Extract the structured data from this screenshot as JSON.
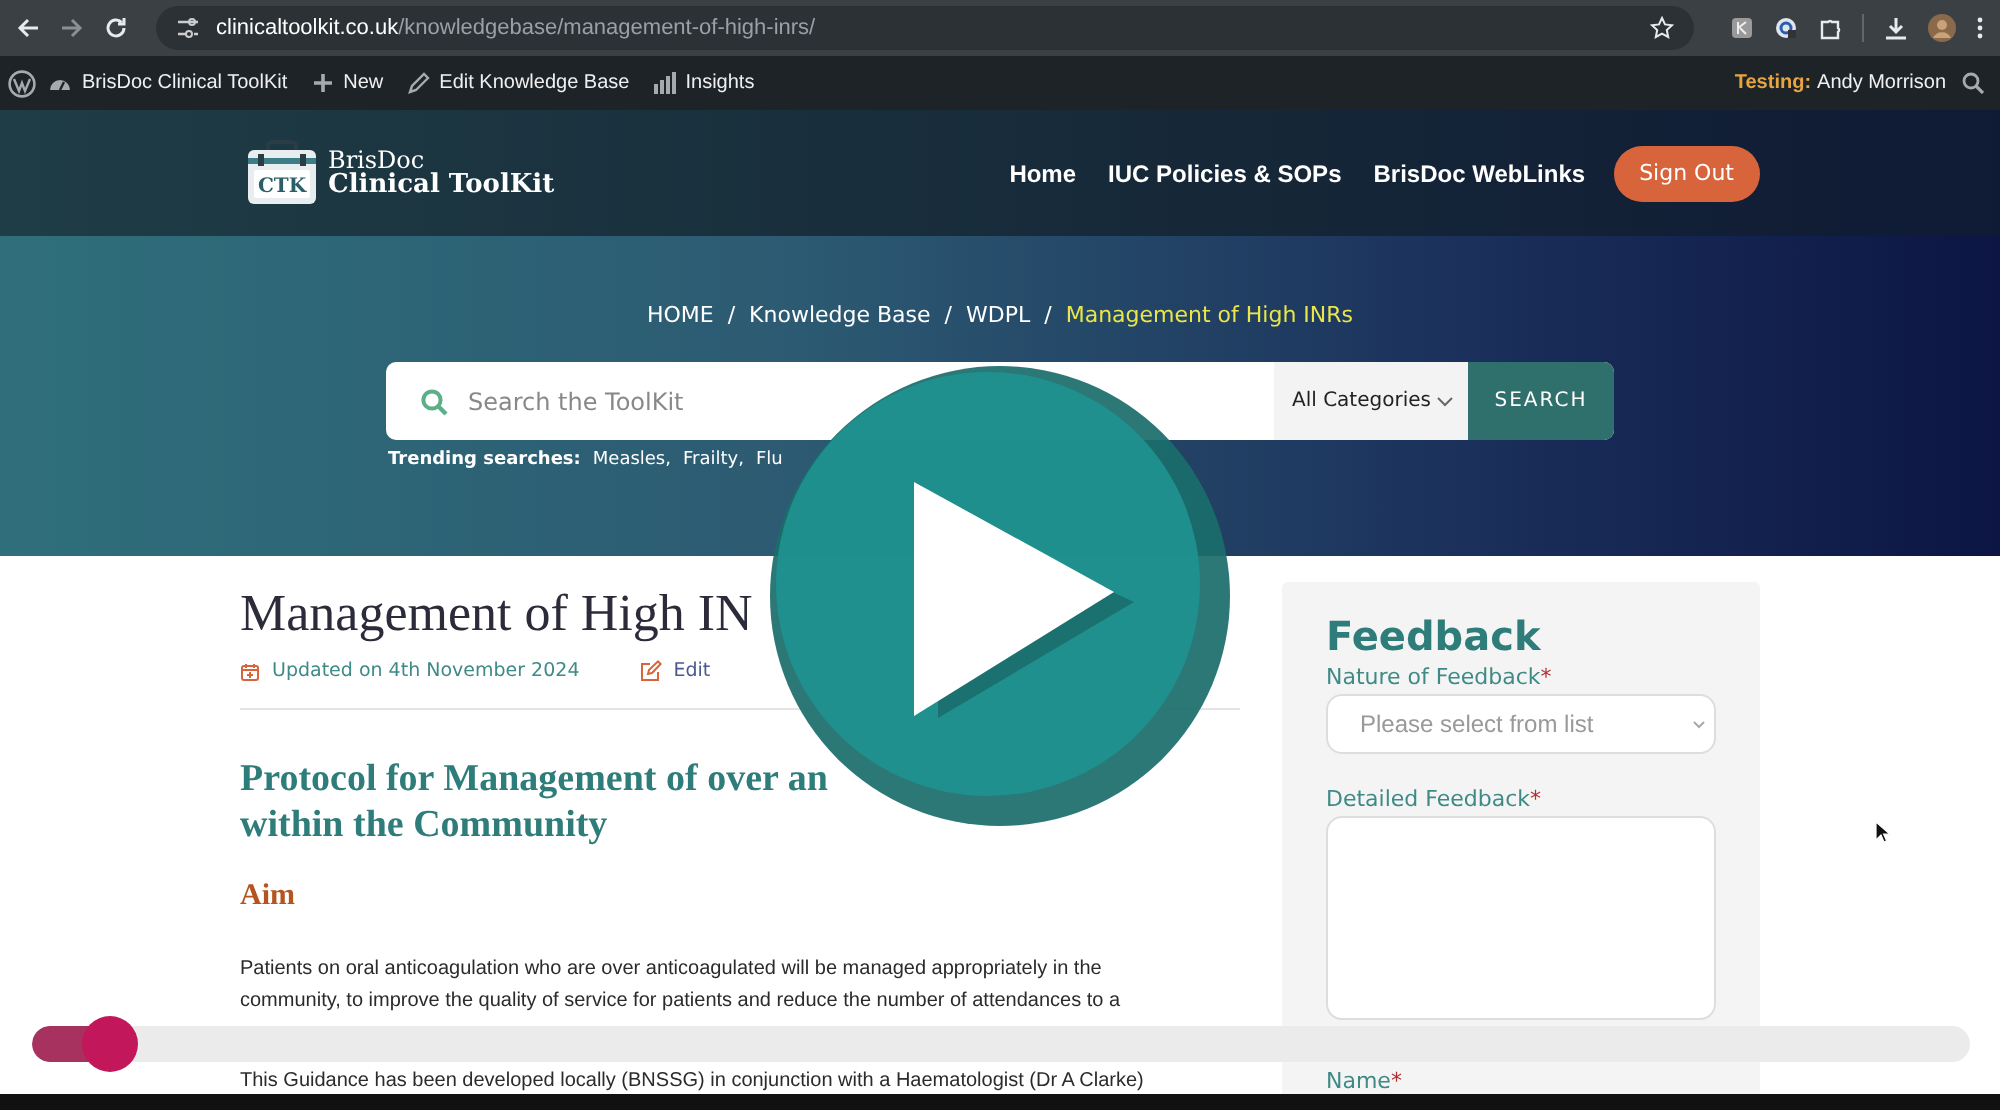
{
  "browser": {
    "url_host": "clinicaltoolkit.co.uk",
    "url_path": "/knowledgebase/management-of-high-inrs/"
  },
  "admin_bar": {
    "items": [
      {
        "label": "BrisDoc Clinical ToolKit",
        "kind": "site"
      },
      {
        "label": "New",
        "kind": "new"
      },
      {
        "label": "Edit Knowledge Base",
        "kind": "edit"
      },
      {
        "label": "Insights",
        "kind": "stats"
      }
    ],
    "testing_label": "Testing:",
    "user": "Andy Morrison"
  },
  "site_header": {
    "logo_badge": "CTK",
    "logo_line1": "BrisDoc",
    "logo_line2": "Clinical ToolKit",
    "nav": [
      "Home",
      "IUC Policies & SOPs",
      "BrisDoc WebLinks"
    ],
    "sign_out": "Sign Out"
  },
  "hero": {
    "breadcrumb_separator": "/",
    "breadcrumbs": [
      {
        "label": "HOME",
        "selected": false
      },
      {
        "label": "Knowledge Base",
        "selected": false
      },
      {
        "label": "WDPL",
        "selected": false
      },
      {
        "label": "Management of High INRs",
        "selected": true
      }
    ],
    "search": {
      "placeholder": "Search the ToolKit",
      "category": "All Categories",
      "button": "SEARCH"
    },
    "trending_label": "Trending searches:",
    "trending": [
      "Measles,",
      "Frailty,",
      "Flu"
    ]
  },
  "article": {
    "title": "Management of High IN",
    "updated": "Updated on 4th November 2024",
    "edit": "Edit",
    "heading_lines": [
      "Protocol for Management of over an",
      "within the Community"
    ],
    "subheading": "Aim",
    "paragraphs": [
      {
        "lines": [
          "Patients on oral anticoagulation who are over anticoagulated will be managed appropriately in the",
          "community, to improve the quality of service for patients and reduce the number of attendances to a"
        ]
      },
      {
        "lines": [
          "This Guidance has been developed locally (BNSSG) in conjunction with a Haematologist (Dr A Clarke)"
        ]
      }
    ]
  },
  "feedback": {
    "title": "Feedback",
    "fields": [
      {
        "label": "Nature of Feedback",
        "required_mark": "*",
        "kind": "select",
        "placeholder": "Please select from list"
      },
      {
        "label": "Detailed Feedback",
        "required_mark": "*",
        "kind": "textarea"
      },
      {
        "label": "Name",
        "required_mark": "*",
        "kind": "text"
      }
    ]
  },
  "player": {
    "progress": {
      "level": 0.04
    }
  }
}
